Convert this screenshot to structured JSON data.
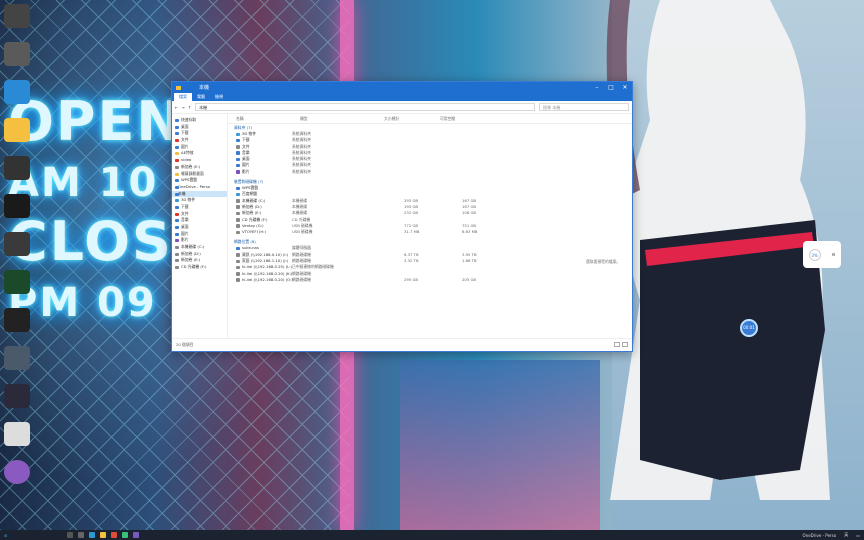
{
  "wallpaper": {
    "neon_lines": [
      "OPEN",
      "AM 10",
      "CLOS",
      "PM 09"
    ]
  },
  "window": {
    "title": "本機",
    "ribbon_tabs": [
      "檔案",
      "電腦",
      "檢視"
    ],
    "breadcrumb": "本機",
    "search_placeholder": "搜尋 本機",
    "columns": {
      "name": "名稱",
      "type": "類型",
      "total": "大小總計",
      "free": "可用空間"
    },
    "nav_items": [
      {
        "label": "快速存取",
        "color": "#3a7bd5"
      },
      {
        "label": "桌面",
        "color": "#3a7bd5"
      },
      {
        "label": "下載",
        "color": "#3a7bd5"
      },
      {
        "label": "文件",
        "color": "#e0332a"
      },
      {
        "label": "圖片",
        "color": "#3a7bd5"
      },
      {
        "label": "AE特效",
        "color": "#f5c040"
      },
      {
        "label": "video",
        "color": "#e0332a"
      },
      {
        "label": "新加卷 (E:)",
        "color": "#888"
      },
      {
        "label": "螢幕錄影畫面",
        "color": "#f5c040"
      },
      {
        "label": "WPS雲盤",
        "color": "#3a7bd5"
      },
      {
        "label": "OneDrive - Perso",
        "color": "#3a7bd5"
      },
      {
        "label": "本機",
        "color": "#3a7bd5",
        "selected": true
      },
      {
        "label": "3D 物件",
        "color": "#3a9ad5"
      },
      {
        "label": "下載",
        "color": "#3a7bd5"
      },
      {
        "label": "文件",
        "color": "#e0332a"
      },
      {
        "label": "音樂",
        "color": "#3a7bd5"
      },
      {
        "label": "桌面",
        "color": "#3a7bd5"
      },
      {
        "label": "圖片",
        "color": "#3a7bd5"
      },
      {
        "label": "影片",
        "color": "#7a4fc0"
      },
      {
        "label": "本機磁碟 (C:)",
        "color": "#888"
      },
      {
        "label": "新加卷 (D:)",
        "color": "#888"
      },
      {
        "label": "新加卷 (E:)",
        "color": "#888"
      },
      {
        "label": "CD 光碟機 (F:)",
        "color": "#888"
      }
    ],
    "groups": [
      {
        "label": "資料夾 (7)",
        "rows": [
          {
            "name": "3D 物件",
            "type": "系統資料夾",
            "size": "",
            "free": "",
            "color": "#3a9ad5"
          },
          {
            "name": "下載",
            "type": "系統資料夾",
            "size": "",
            "free": "",
            "color": "#3a7bd5"
          },
          {
            "name": "文件",
            "type": "系統資料夾",
            "size": "",
            "free": "",
            "color": "#8a8a8a"
          },
          {
            "name": "音樂",
            "type": "系統資料夾",
            "size": "",
            "free": "",
            "color": "#3a7bd5"
          },
          {
            "name": "桌面",
            "type": "系統資料夾",
            "size": "",
            "free": "",
            "color": "#3a7bd5"
          },
          {
            "name": "圖片",
            "type": "系統資料夾",
            "size": "",
            "free": "",
            "color": "#3a7bd5"
          },
          {
            "name": "影片",
            "type": "系統資料夾",
            "size": "",
            "free": "",
            "color": "#7a4fc0"
          }
        ]
      },
      {
        "label": "裝置和磁碟機 (7)",
        "rows": [
          {
            "name": "WPS雲盤",
            "type": "",
            "size": "",
            "free": "",
            "color": "#3a7bd5"
          },
          {
            "name": "百度網盤",
            "type": "",
            "size": "",
            "free": "",
            "color": "#3a9ad5"
          },
          {
            "name": "本機磁碟 (C:)",
            "type": "本機磁碟",
            "size": "293 GB",
            "free": "167 GB",
            "color": "#888"
          },
          {
            "name": "新加卷 (D:)",
            "type": "本機磁碟",
            "size": "195 GB",
            "free": "167 GB",
            "color": "#888"
          },
          {
            "name": "新加卷 (E:)",
            "type": "本機磁碟",
            "size": "232 GB",
            "free": "108 GB",
            "color": "#888"
          },
          {
            "name": "CD 光碟機 (F:)",
            "type": "CD 光碟機",
            "size": "",
            "free": "",
            "color": "#888"
          },
          {
            "name": "Ventoy (G:)",
            "type": "USB 磁碟機",
            "size": "772 GB",
            "free": "751 GB",
            "color": "#888"
          },
          {
            "name": "VTOYEFI (H:)",
            "type": "USB 磁碟機",
            "size": "31.7 MB",
            "free": "6.63 MB",
            "color": "#888"
          }
        ]
      },
      {
        "label": "網路位置 (6)",
        "rows": [
          {
            "name": "suke-nas",
            "type": "媒體伺服器",
            "size": "",
            "free": "",
            "color": "#3a7bd5"
          },
          {
            "name": "資訊 (\\\\192.168.0.10) (I:)",
            "type": "網路磁碟機",
            "size": "6.37 TB",
            "free": "3.95 TB",
            "color": "#888"
          },
          {
            "name": "家庭 (\\\\192.168.1.10) (J:)",
            "type": "網路磁碟機",
            "size": "3.32 TB",
            "free": "1.66 TB",
            "color": "#888"
          },
          {
            "name": "hi-liei (\\\\192.168.0.25) (L:)",
            "type": "已中斷連線的網路磁碟機",
            "size": "",
            "free": "",
            "color": "#888"
          },
          {
            "name": "hi-liei (\\\\192.168.0.20) (K:)",
            "type": "網路磁碟機",
            "size": "",
            "free": "",
            "color": "#888"
          },
          {
            "name": "hi-liei (\\\\192.168.0.20) (O:)",
            "type": "網路磁碟機",
            "size": "295 GB",
            "free": "205 GB",
            "color": "#888"
          }
        ]
      }
    ],
    "preview_text": "選取要預覽的檔案。",
    "status": "20 個項目"
  },
  "widget": {
    "value": "3%"
  },
  "clock_badge": "00:01",
  "taskbar": {
    "tray_text": "OneDrive - Perso",
    "lang": "英"
  }
}
